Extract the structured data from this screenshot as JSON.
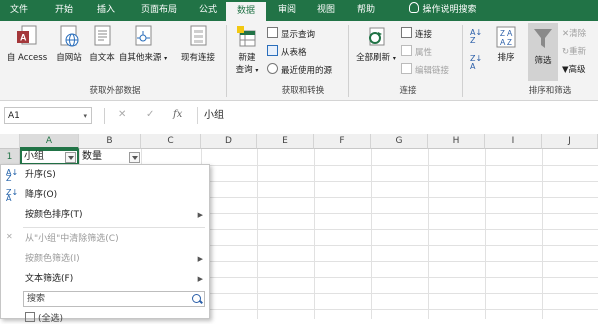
{
  "tabs": [
    "文件",
    "开始",
    "插入",
    "页面布局",
    "公式",
    "数据",
    "审阅",
    "视图",
    "帮助",
    "操作说明搜索"
  ],
  "active_tab": "数据",
  "ribbon": {
    "get_external": {
      "from_access": "自 Access",
      "from_web": "自网站",
      "from_text": "自文本",
      "from_other": "自其他来源",
      "existing_conn": "现有连接",
      "group_label": "获取外部数据"
    },
    "get_transform": {
      "new_query": "新建",
      "new_query2": "查询",
      "show_queries": "显示查询",
      "from_table": "从表格",
      "recent_sources": "最近使用的源",
      "group_label": "获取和转换"
    },
    "connections": {
      "refresh_all": "全部刷新",
      "connections": "连接",
      "properties": "属性",
      "edit_links": "编辑链接",
      "group_label": "连接"
    },
    "sort_filter": {
      "sort": "排序",
      "filter": "筛选",
      "clear": "清除",
      "reapply": "重新",
      "advanced": "高级",
      "group_label": "排序和筛选"
    }
  },
  "formula_bar": {
    "name_box": "A1",
    "cancel": "✕",
    "enter": "✓",
    "fx": "fx",
    "content": "小组"
  },
  "grid": {
    "columns": [
      "A",
      "B",
      "C",
      "D",
      "E",
      "F",
      "G",
      "H",
      "I",
      "J"
    ],
    "row1": "1",
    "a1": "小组",
    "b1": "数量"
  },
  "filter_menu": {
    "sort_asc": "升序(S)",
    "sort_desc": "降序(O)",
    "sort_by_color": "按颜色排序(T)",
    "clear_filter": "从\"小组\"中清除筛选(C)",
    "filter_by_color": "按颜色筛选(I)",
    "text_filters": "文本筛选(F)",
    "search_placeholder": "搜索",
    "partial_item": "(全选)"
  }
}
